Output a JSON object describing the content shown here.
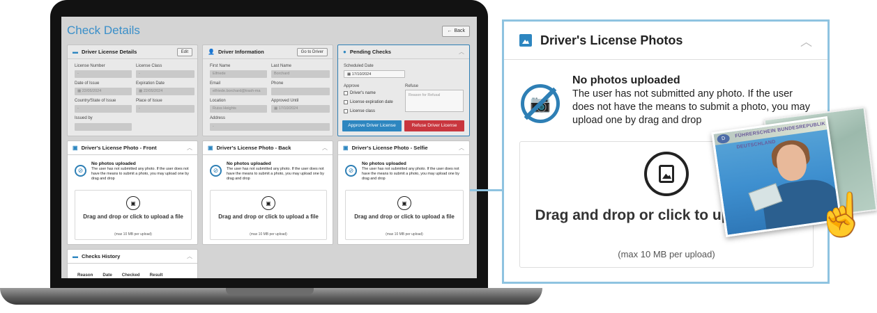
{
  "app": {
    "title": "Check Details",
    "back_label": "Back"
  },
  "license_details": {
    "title": "Driver License Details",
    "edit_label": "Edit",
    "fields": [
      {
        "label": "License Number",
        "value": "-"
      },
      {
        "label": "License Class",
        "value": "-"
      },
      {
        "label": "Date of Issue",
        "value": "22/05/2024"
      },
      {
        "label": "Expiration Date",
        "value": "22/05/2024"
      },
      {
        "label": "Country/State of Issue",
        "value": "-"
      },
      {
        "label": "Place of Issue",
        "value": "-"
      },
      {
        "label": "Issued by",
        "value": ""
      }
    ]
  },
  "driver_info": {
    "title": "Driver Information",
    "goto_label": "Go to Driver",
    "fields": [
      {
        "label": "First Name",
        "value": "Elfriede"
      },
      {
        "label": "Last Name",
        "value": "Borchard"
      },
      {
        "label": "Email",
        "value": "elfriede.borchard@trash-ma"
      },
      {
        "label": "Phone",
        "value": ""
      },
      {
        "label": "Location",
        "value": "Ruiss Heights"
      },
      {
        "label": "Approved Until",
        "value": "17/10/2024"
      },
      {
        "label": "Address",
        "value": "-"
      }
    ]
  },
  "pending": {
    "title": "Pending Checks",
    "scheduled_label": "Scheduled Date",
    "scheduled_value": "17/10/2024",
    "approve_label": "Approve",
    "refuse_label": "Refuse",
    "checks": [
      "Driver's name",
      "License expiration date",
      "License class"
    ],
    "refuse_placeholder": "Reason for Refusal",
    "approve_button": "Approve Driver License",
    "refuse_button": "Refuse Driver License"
  },
  "photo_card": {
    "no_photo_title": "No photos uploaded",
    "no_photo_text": "The user has not submitted any photo. If the user does not have the means to submit a photo, you may upload one by drag and drop",
    "drop_text": "Drag and drop or click to upload a file",
    "drop_hint": "(max 10 MB per upload)"
  },
  "photo_cards": [
    {
      "title": "Driver's License Photo - Front"
    },
    {
      "title": "Driver's License Photo - Back"
    },
    {
      "title": "Driver's License Photo - Selfie"
    }
  ],
  "history": {
    "title": "Checks History",
    "columns": [
      "Reason",
      "Date",
      "Checked",
      "Result"
    ]
  },
  "zoom": {
    "title": "Driver's License Photos"
  },
  "photo_overlay": {
    "license_text": "FÜHRERSCHEIN BUNDESREPUBLIK DEUTSCHLAND",
    "license_badge": "D"
  },
  "colors": {
    "accent": "#2e7fb5",
    "approve": "#2d86c0",
    "refuse": "#c9363e",
    "callout_border": "#8ec3e0"
  }
}
